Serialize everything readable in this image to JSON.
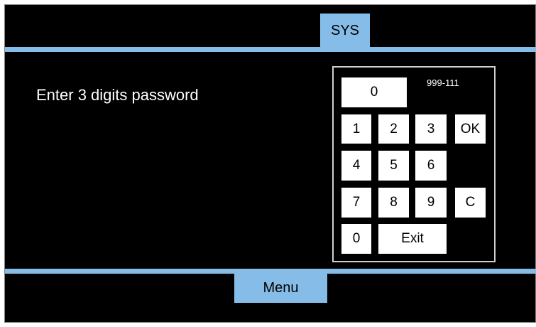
{
  "header": {
    "tab_label": "SYS"
  },
  "prompt": "Enter 3 digits password",
  "keypad": {
    "display_value": "0",
    "hint": "999-111",
    "keys": {
      "k1": "1",
      "k2": "2",
      "k3": "3",
      "ok": "OK",
      "k4": "4",
      "k5": "5",
      "k6": "6",
      "k7": "7",
      "k8": "8",
      "k9": "9",
      "clear": "C",
      "k0": "0",
      "exit": "Exit"
    }
  },
  "footer": {
    "menu_label": "Menu"
  },
  "colors": {
    "background": "#000000",
    "accent": "#86bde8",
    "key": "#ffffff"
  }
}
